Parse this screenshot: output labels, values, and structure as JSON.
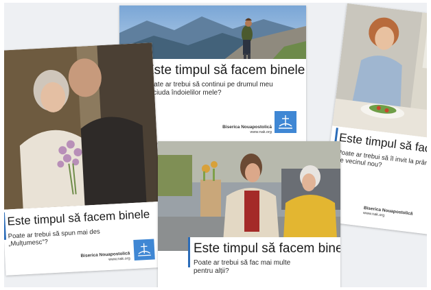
{
  "brand_color": "#3f87d4",
  "accent_color": "#2b6cb8",
  "logo_icon": "church-cross-sun-icon",
  "cards": {
    "hiker": {
      "headline": "Este timpul să facem binele",
      "question_lines": [
        "Poate ar trebui să continui pe drumul meu",
        "în ciuda îndoielilor mele?"
      ],
      "brand": "Biserica Nouapostolică",
      "url": "www.nak.org"
    },
    "couple": {
      "headline": "Este timpul să facem binele",
      "question_lines": [
        "Poate ar trebui să spun mai des",
        "„Mulțumesc”?"
      ],
      "brand": "Biserica Nouapostolică",
      "url": "www.nak.org"
    },
    "women": {
      "headline": "Este timpul să facem binele",
      "question_lines": [
        "Poate ar trebui să fac mai multe",
        "pentru alții?"
      ],
      "brand": "Biserica Nouapostolică",
      "url": "www.nak.org"
    },
    "dinner": {
      "headline": "Este timpul să facem binele",
      "question_lines": [
        "Poate ar trebui să îl invit la prânz",
        "pe vecinul nou?"
      ],
      "brand": "Biserica Nouapostolică",
      "url": "www.nak.org"
    }
  }
}
